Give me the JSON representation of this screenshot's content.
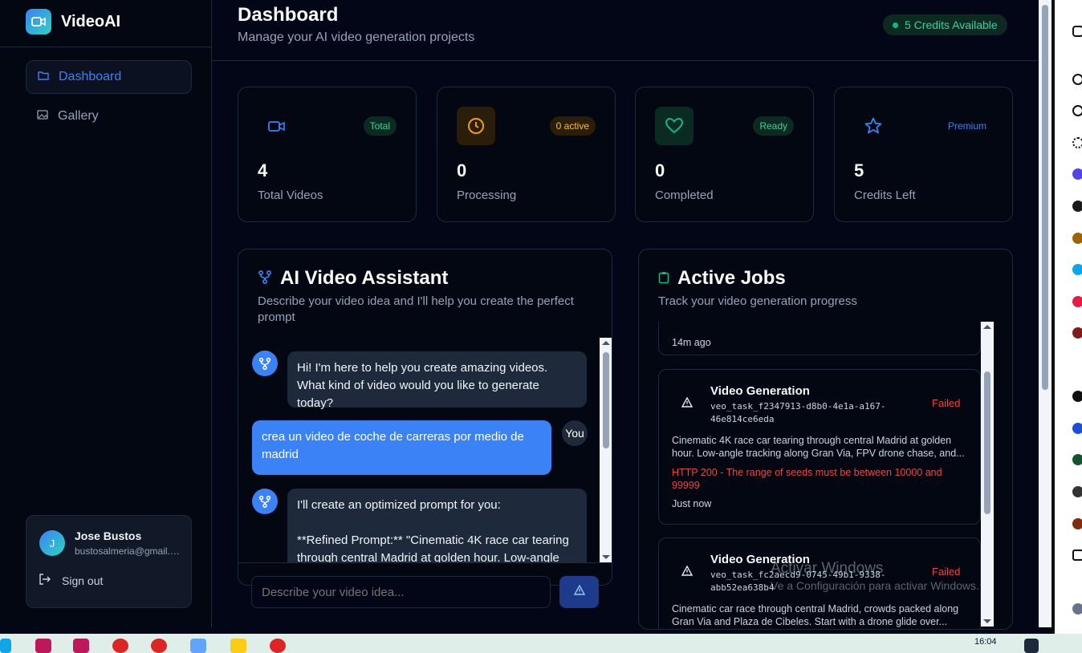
{
  "app": {
    "name": "VideoAI"
  },
  "sidebar": {
    "items": [
      {
        "label": "Dashboard",
        "icon": "folder-icon",
        "active": true
      },
      {
        "label": "Gallery",
        "icon": "image-icon",
        "active": false
      }
    ],
    "user": {
      "initial": "J",
      "name": "Jose Bustos",
      "email": "bustosalmeria@gmail.com",
      "signout_label": "Sign out"
    }
  },
  "header": {
    "title": "Dashboard",
    "subtitle": "Manage your AI video generation projects",
    "credits_badge": "5 Credits Available"
  },
  "stats": [
    {
      "value": "4",
      "label": "Total Videos",
      "badge": "Total",
      "icon": "video-camera-icon",
      "color": "#3b82f6"
    },
    {
      "value": "0",
      "label": "Processing",
      "badge": "0 active",
      "icon": "clock-icon",
      "color": "#f59e0b"
    },
    {
      "value": "0",
      "label": "Completed",
      "badge": "Ready",
      "icon": "heart-icon",
      "color": "#10b981"
    },
    {
      "value": "5",
      "label": "Credits Left",
      "badge": "Premium",
      "icon": "star-icon",
      "color": "#3b82f6"
    }
  ],
  "assistant": {
    "title": "AI Video Assistant",
    "subtitle": "Describe your video idea and I'll help you create the perfect prompt",
    "messages": [
      {
        "from": "bot",
        "text": "Hi! I'm here to help you create amazing videos. What kind of video would you like to generate today?"
      },
      {
        "from": "user",
        "avatar": "You",
        "text": "crea un video de coche de carreras por medio de madrid"
      },
      {
        "from": "bot",
        "text": "I'll create an optimized prompt for you:\n\n**Refined Prompt:** \"Cinematic 4K race car tearing through central Madrid at golden hour. Low-angle"
      }
    ],
    "input_placeholder": "Describe your video idea..."
  },
  "jobs": {
    "title": "Active Jobs",
    "subtitle": "Track your video generation progress",
    "partial_time": "14m ago",
    "items": [
      {
        "title": "Video Generation",
        "id": "veo_task_f2347913-d8b0-4e1a-a167-46e814ce6eda",
        "status": "Failed",
        "description": "Cinematic 4K race car tearing through central Madrid at golden hour. Low-angle tracking along Gran Via, FPV drone chase, and...",
        "error": "HTTP 200 - The range of seeds must be between 10000 and 99999",
        "time": "Just now"
      },
      {
        "title": "Video Generation",
        "id": "veo_task_fc2aecd9-0745-49b1-9338-abb52ea638b4",
        "status": "Failed",
        "description": "Cinematic car race through central Madrid, crowds packed along Gran Via and Plaza de Cibeles. Start with a drone glide over..."
      }
    ]
  },
  "watermark": {
    "line1": "Activar Windows",
    "line2": "Ve a Configuración para activar Windows."
  },
  "taskbar": {
    "clock": "16:04"
  }
}
